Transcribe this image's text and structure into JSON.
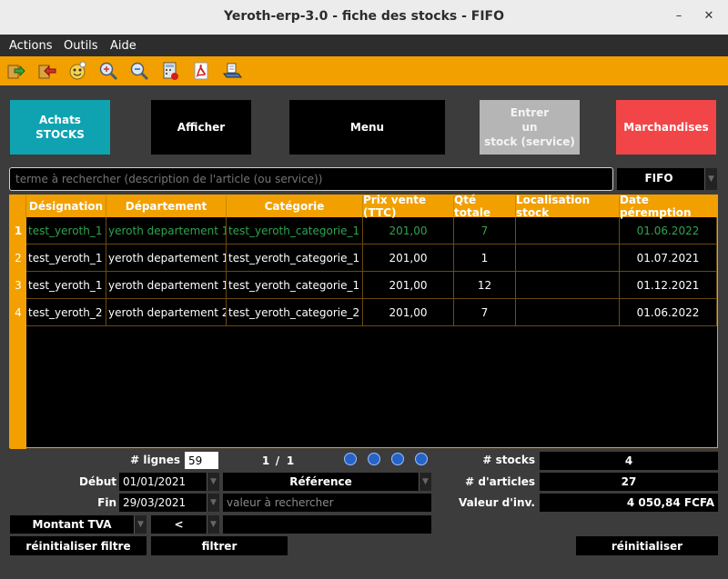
{
  "window": {
    "title": "Yeroth-erp-3.0 - fiche des stocks - FIFO"
  },
  "menu": [
    "Actions",
    "Outils",
    "Aide"
  ],
  "toolbar_icons": [
    "export-icon",
    "back-icon",
    "face-icon",
    "zoom-in-icon",
    "zoom-out-icon",
    "calculator-print-icon",
    "pdf-icon",
    "scanner-icon"
  ],
  "buttons": {
    "achats": "Achats\nSTOCKS",
    "afficher": "Afficher",
    "menu": "Menu",
    "entrer": "Entrer\nun\nstock (service)",
    "marchandises": "Marchandises"
  },
  "colors": {
    "accent": "#f2a000",
    "achats": "#0fa3b1",
    "entrer": "#b5b5b5",
    "marchandises": "#f24548",
    "highlight_text": "#2ea44f"
  },
  "search": {
    "placeholder": "terme à rechercher (description de l'article (ou service))",
    "mode": "FIFO"
  },
  "table": {
    "headers": [
      "Désignation",
      "Département",
      "Catégorie",
      "Prix vente (TTC)",
      "Qté totale",
      "Localisation stock",
      "Date péremption"
    ],
    "rows": [
      {
        "num": "1",
        "cells": [
          "test_yeroth_1",
          "yeroth departement 1",
          "test_yeroth_categorie_1",
          "201,00",
          "7",
          "",
          "01.06.2022"
        ]
      },
      {
        "num": "2",
        "cells": [
          "test_yeroth_1",
          "yeroth departement 1",
          "test_yeroth_categorie_1",
          "201,00",
          "1",
          "",
          "01.07.2021"
        ]
      },
      {
        "num": "3",
        "cells": [
          "test_yeroth_1",
          "yeroth departement 1",
          "test_yeroth_categorie_1",
          "201,00",
          "12",
          "",
          "01.12.2021"
        ]
      },
      {
        "num": "4",
        "cells": [
          "test_yeroth_2",
          "yeroth departement 2",
          "test_yeroth_categorie_2",
          "201,00",
          "7",
          "",
          "01.06.2022"
        ]
      }
    ]
  },
  "paging": {
    "lines_label": "# lignes",
    "lines_value": "59",
    "page_current": "1",
    "page_sep": "/",
    "page_total": "1"
  },
  "filters": {
    "debut_label": "Début",
    "debut_value": "01/01/2021",
    "fin_label": "Fin",
    "fin_value": "29/03/2021",
    "reference": "Référence",
    "search_placeholder": "valeur à rechercher",
    "montant": "Montant TVA",
    "operator": "<",
    "reset_filter": "réinitialiser filtre",
    "filter": "filtrer"
  },
  "stats": {
    "stocks_label": "# stocks",
    "stocks_value": "4",
    "articles_label": "# d'articles",
    "articles_value": "27",
    "valeur_label": "Valeur d'inv.",
    "valeur_value": "4 050,84 FCFA",
    "reset": "réinitialiser"
  }
}
